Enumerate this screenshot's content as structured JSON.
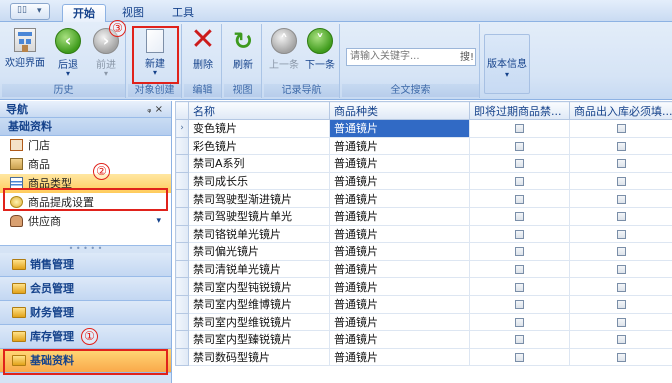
{
  "title_tabs": [
    "开始",
    "视图",
    "工具"
  ],
  "ribbon": {
    "groups": [
      {
        "label": "历史",
        "buttons": [
          "欢迎界面",
          "后退",
          "前进"
        ]
      },
      {
        "label": "对象创建",
        "buttons": [
          "新建"
        ]
      },
      {
        "label": "编辑",
        "buttons": [
          "删除"
        ]
      },
      {
        "label": "视图",
        "buttons": [
          "刷新"
        ]
      },
      {
        "label": "记录导航",
        "buttons": [
          "上一条",
          "下一条"
        ]
      },
      {
        "label": "全文搜索",
        "buttons": []
      },
      {
        "label": "",
        "buttons": [
          "版本信息"
        ]
      }
    ],
    "search_placeholder": "请输入关键字...",
    "search_button": "搜!"
  },
  "annotations": {
    "n1": "①",
    "n2": "②",
    "n3": "③"
  },
  "nav": {
    "title": "导航",
    "pins": "ᵩ ×",
    "current_section": "基础资料",
    "items": [
      "门店",
      "商品",
      "商品类型",
      "商品提成设置",
      "供应商"
    ],
    "categories": [
      "销售管理",
      "会员管理",
      "财务管理",
      "库存管理",
      "基础资料"
    ]
  },
  "grid": {
    "columns": [
      "名称",
      "商品种类",
      "即将过期商品禁...",
      "商品出入库必须填..."
    ],
    "rows": [
      {
        "name": "变色镜片",
        "type": "普通镜片"
      },
      {
        "name": "彩色镜片",
        "type": "普通镜片"
      },
      {
        "name": "禁司A系列",
        "type": "普通镜片"
      },
      {
        "name": "禁司成长乐",
        "type": "普通镜片"
      },
      {
        "name": "禁司驾驶型渐进镜片",
        "type": "普通镜片"
      },
      {
        "name": "禁司驾驶型镜片单光",
        "type": "普通镜片"
      },
      {
        "name": "禁司铬锐单光镜片",
        "type": "普通镜片"
      },
      {
        "name": "禁司偏光镜片",
        "type": "普通镜片"
      },
      {
        "name": "禁司清锐单光镜片",
        "type": "普通镜片"
      },
      {
        "name": "禁司室内型钝锐镜片",
        "type": "普通镜片"
      },
      {
        "name": "禁司室内型维博镜片",
        "type": "普通镜片"
      },
      {
        "name": "禁司室内型维锐镜片",
        "type": "普通镜片"
      },
      {
        "name": "禁司室内型臻锐镜片",
        "type": "普通镜片"
      },
      {
        "name": "禁司数码型镜片",
        "type": "普通镜片"
      }
    ]
  }
}
